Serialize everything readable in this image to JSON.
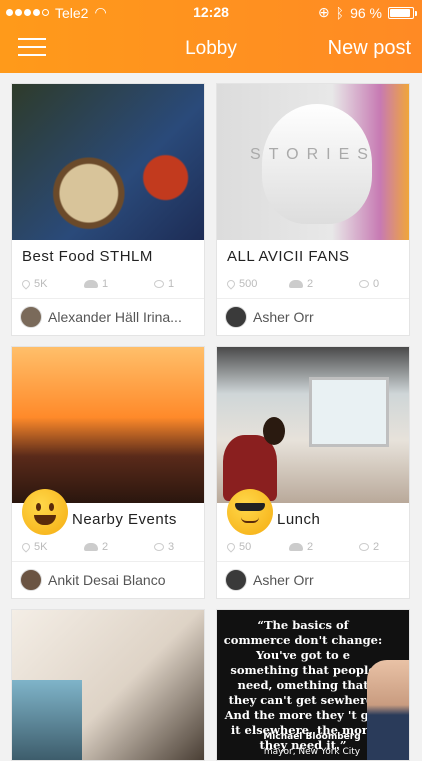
{
  "status_bar": {
    "carrier": "Tele2",
    "time": "12:28",
    "battery": "96 %"
  },
  "nav": {
    "title": "Lobby",
    "new_post": "New post"
  },
  "cards": [
    {
      "title": "Best Food STHLM",
      "stat_location": "5K",
      "stat_members": "1",
      "stat_comments": "1",
      "owner": "Alexander Häll Irina..."
    },
    {
      "title": "ALL AVICII FANS",
      "stat_location": "500",
      "stat_members": "2",
      "stat_comments": "0",
      "owner": "Asher Orr",
      "image_text": "STORIES"
    },
    {
      "title": "Nearby Events",
      "stat_location": "5K",
      "stat_members": "2",
      "stat_comments": "3",
      "owner": "Ankit Desai Blanco",
      "emoji": "smiley-face-icon"
    },
    {
      "title": "Lunch",
      "stat_location": "50",
      "stat_members": "2",
      "stat_comments": "2",
      "owner": "Asher Orr",
      "emoji": "sunglasses-face-icon"
    }
  ],
  "quote_card": {
    "quote": "“The basics of commerce don't change: You've got to e something that people need, omething that they can't get sewhere. And the more they 't get it elsewhere, the more they need it.”",
    "author": "Michael Bloomberg",
    "author_title": "mayor, New York City"
  },
  "colors": {
    "header_start": "#ff9a1a",
    "header_end": "#ff8a24",
    "background": "#f2f2f2"
  }
}
